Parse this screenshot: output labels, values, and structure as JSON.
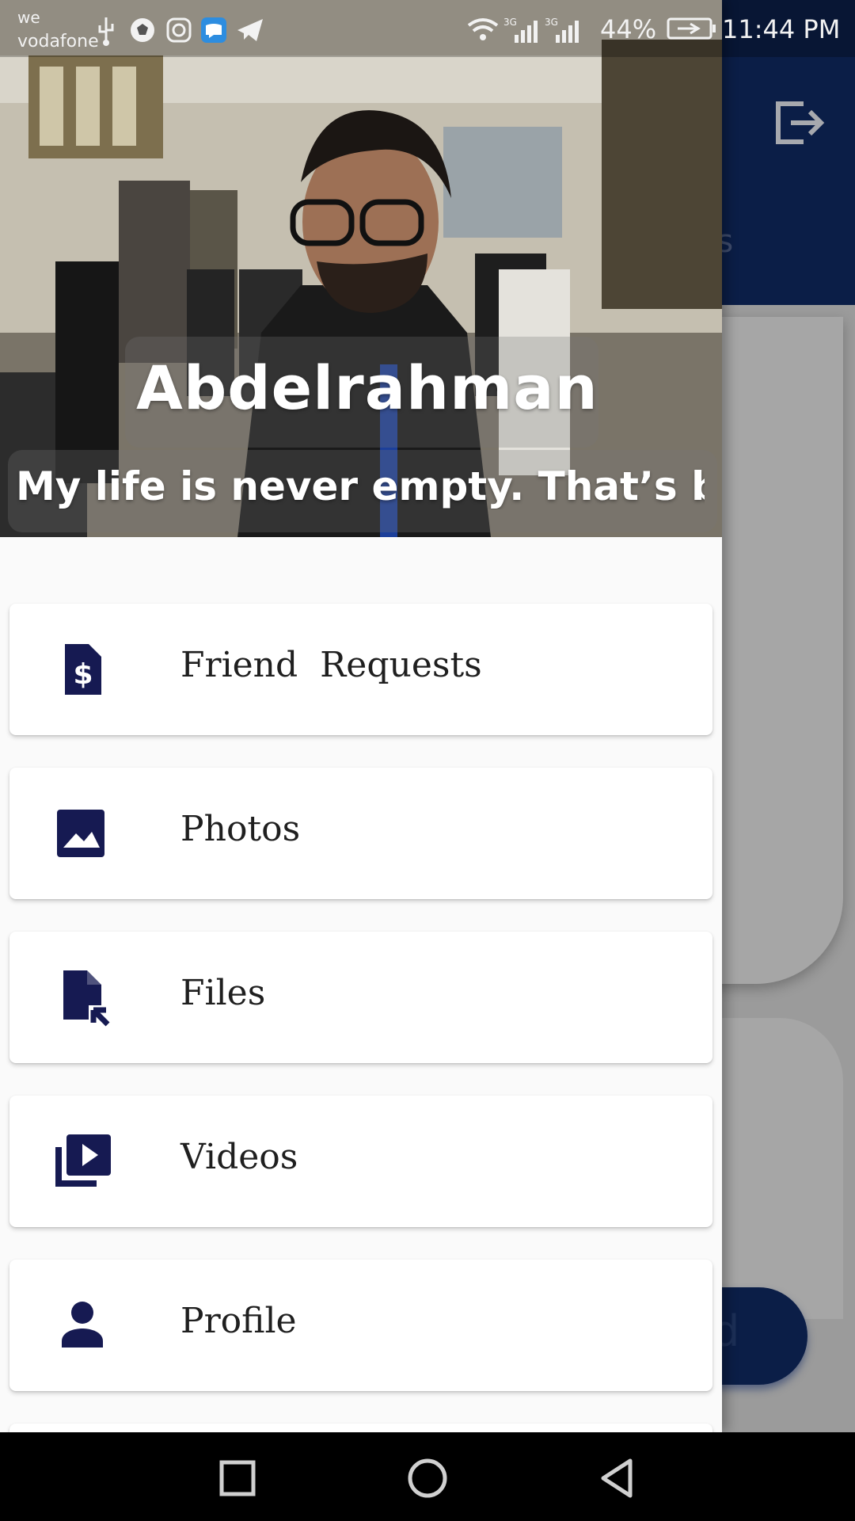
{
  "status_bar": {
    "carrier_top": "we",
    "carrier_bottom": "vodafone",
    "network_1": "3G",
    "network_2": "3G",
    "battery": "44%",
    "time": "11:44 PM"
  },
  "background_screen": {
    "partial_title": "us",
    "partial_button_label": "d"
  },
  "drawer": {
    "header": {
      "name": "Abdelrahman",
      "motto": "My life is never empty. That’s be"
    },
    "menu_items": [
      {
        "label": "Friend  Requests",
        "icon": "request-quote-icon"
      },
      {
        "label": "Photos",
        "icon": "image-icon"
      },
      {
        "label": "Files",
        "icon": "file-icon"
      },
      {
        "label": "Videos",
        "icon": "video-library-icon"
      },
      {
        "label": "Profile",
        "icon": "person-icon"
      }
    ]
  },
  "colors": {
    "primary": "#0b1e47",
    "icon": "#161a52",
    "drawer_bg": "#fafafa",
    "card_bg": "#ffffff",
    "text": "#1f1f1f"
  }
}
